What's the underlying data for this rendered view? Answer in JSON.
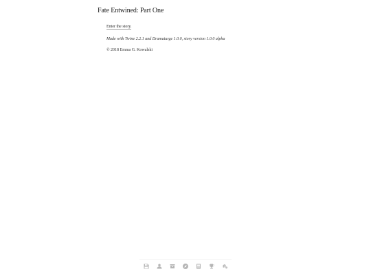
{
  "story": {
    "title": "Fate Entwined: Part One",
    "enter_link": "Enter the story.",
    "made_with": "Made with Twine 2.2.1 and Dramaturge 1.0.0, story version 1.0.0 alpha",
    "copyright": "© 2018 Emma G. Kowalski"
  },
  "toolbar": {
    "icons": [
      "save-icon",
      "character-icon",
      "inventory-icon",
      "compass-icon",
      "journal-icon",
      "trophy-icon",
      "settings-icon"
    ],
    "icon_color": "#b5b5b5"
  }
}
